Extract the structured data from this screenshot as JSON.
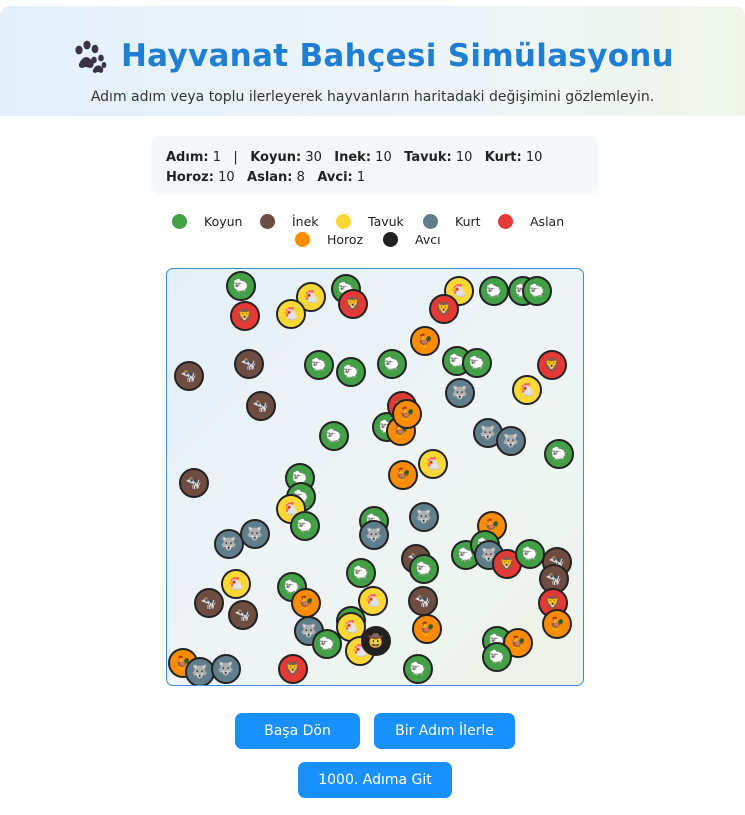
{
  "header": {
    "title": "Hayvanat Bahçesi Simülasyonu",
    "subtitle": "Adım adım veya toplu ilerleyerek hayvanların haritadaki değişimini gözlemleyin.",
    "icon": "paw-icon"
  },
  "stats": {
    "step_label": "Adım:",
    "step_value": "1",
    "separator": "|",
    "sheep_label": "Koyun:",
    "sheep_value": "30",
    "cow_label": "Inek:",
    "cow_value": "10",
    "chicken_label": "Tavuk:",
    "chicken_value": "10",
    "wolf_label": "Kurt:",
    "wolf_value": "10",
    "rooster_label": "Horoz:",
    "rooster_value": "10",
    "lion_label": "Aslan:",
    "lion_value": "8",
    "hunter_label": "Avci:",
    "hunter_value": "1"
  },
  "legend": [
    {
      "label": "Koyun",
      "color": "#43a047"
    },
    {
      "label": "İnek",
      "color": "#6d4c41"
    },
    {
      "label": "Tavuk",
      "color": "#fdd835"
    },
    {
      "label": "Kurt",
      "color": "#607d8b"
    },
    {
      "label": "Aslan",
      "color": "#e53935"
    },
    {
      "label": "Horoz",
      "color": "#fb8c00"
    },
    {
      "label": "Avcı",
      "color": "#212121"
    }
  ],
  "animal_types": {
    "koyun": {
      "color": "#43a047",
      "glyph": "🐑",
      "icon": "sheep-icon"
    },
    "inek": {
      "color": "#6d4c41",
      "glyph": "🐄",
      "icon": "cow-icon"
    },
    "tavuk": {
      "color": "#fdd835",
      "glyph": "🐔",
      "icon": "chicken-icon"
    },
    "kurt": {
      "color": "#607d8b",
      "glyph": "🐺",
      "icon": "wolf-icon"
    },
    "aslan": {
      "color": "#e53935",
      "glyph": "🦁",
      "icon": "lion-icon"
    },
    "horoz": {
      "color": "#fb8c00",
      "glyph": "🐓",
      "icon": "rooster-icon"
    },
    "avci": {
      "color": "#212121",
      "glyph": "🤠",
      "icon": "hunter-icon"
    }
  },
  "buttons": {
    "reset": "Başa Dön",
    "step": "Bir Adım İlerle",
    "jump": "1000. Adıma Git"
  }
}
